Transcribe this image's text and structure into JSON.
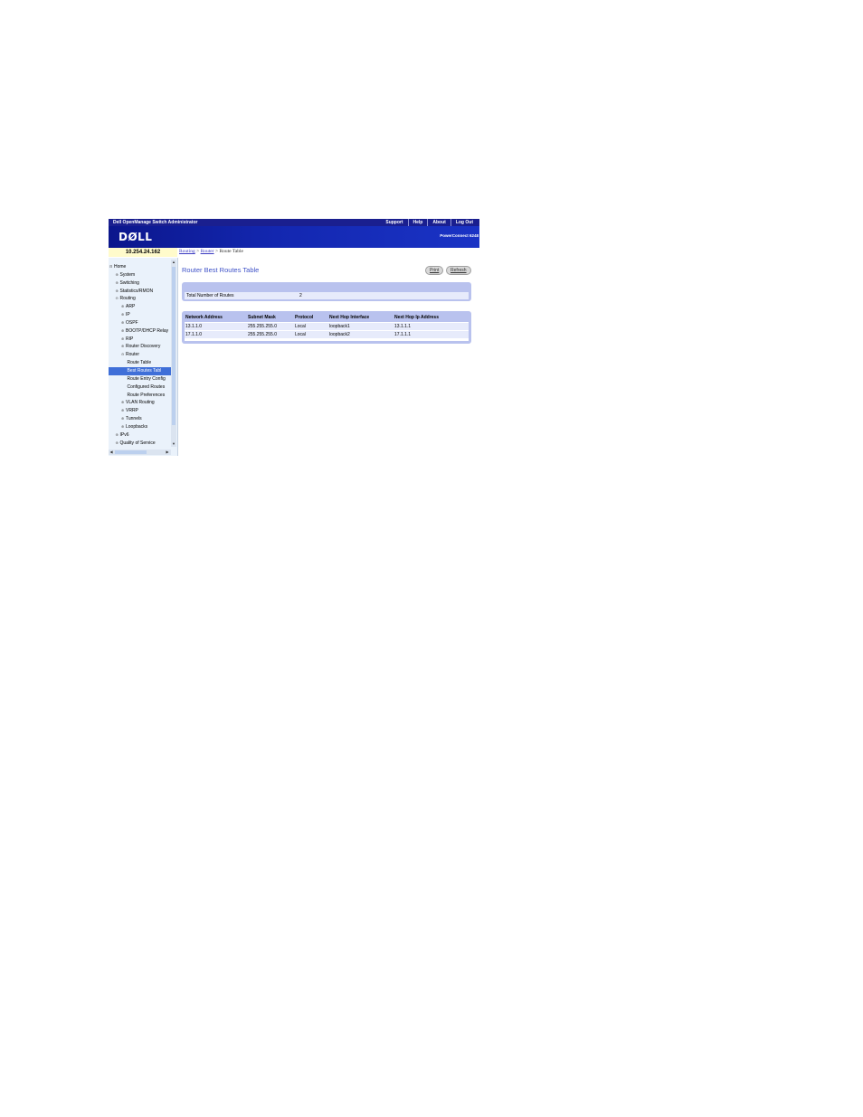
{
  "header": {
    "app_title": "Dell OpenManage Switch Administrator",
    "links": [
      "Support",
      "Help",
      "About",
      "Log Out"
    ],
    "logo_text": "DØLL",
    "model": "PowerConnect 6248"
  },
  "ip_address": "10.254.24.162",
  "breadcrumb": {
    "items": [
      "Routing",
      "Router",
      "Route Table"
    ],
    "separator": ">"
  },
  "sidebar": {
    "items": [
      {
        "label": "Home",
        "level": 0,
        "expander": "⊟"
      },
      {
        "label": "System",
        "level": 1,
        "expander": "⊕"
      },
      {
        "label": "Switching",
        "level": 1,
        "expander": "⊕"
      },
      {
        "label": "Statistics/RMON",
        "level": 1,
        "expander": "⊕"
      },
      {
        "label": "Routing",
        "level": 1,
        "expander": "⊖"
      },
      {
        "label": "ARP",
        "level": 2,
        "expander": "⊕"
      },
      {
        "label": "IP",
        "level": 2,
        "expander": "⊕"
      },
      {
        "label": "OSPF",
        "level": 2,
        "expander": "⊕"
      },
      {
        "label": "BOOTP/DHCP Relay",
        "level": 2,
        "expander": "⊕"
      },
      {
        "label": "RIP",
        "level": 2,
        "expander": "⊕"
      },
      {
        "label": "Router Discovery",
        "level": 2,
        "expander": "⊕"
      },
      {
        "label": "Router",
        "level": 2,
        "expander": "⊖"
      },
      {
        "label": "Route Table",
        "level": 3,
        "expander": ""
      },
      {
        "label": "Best Routes Tabl",
        "level": 3,
        "expander": "",
        "selected": true
      },
      {
        "label": "Route Entry Config",
        "level": 3,
        "expander": ""
      },
      {
        "label": "Configured Routes",
        "level": 3,
        "expander": ""
      },
      {
        "label": "Route Preferences",
        "level": 3,
        "expander": ""
      },
      {
        "label": "VLAN Routing",
        "level": 2,
        "expander": "⊕"
      },
      {
        "label": "VRRP",
        "level": 2,
        "expander": "⊕"
      },
      {
        "label": "Tunnels",
        "level": 2,
        "expander": "⊕"
      },
      {
        "label": "Loopbacks",
        "level": 2,
        "expander": "⊕"
      },
      {
        "label": "IPv6",
        "level": 1,
        "expander": "⊕"
      },
      {
        "label": "Quality of Service",
        "level": 1,
        "expander": "⊕"
      }
    ]
  },
  "page": {
    "title": "Router Best Routes Table",
    "print_label": "Print",
    "refresh_label": "Refresh",
    "summary": {
      "label": "Total Number of Routes",
      "value": "2"
    },
    "table": {
      "columns": [
        "Network Address",
        "Subnet Mask",
        "Protocol",
        "Next Hop Interface",
        "Next Hop Ip Address"
      ],
      "rows": [
        [
          "13.1.1.0",
          "255.255.255.0",
          "Local",
          "loopback1",
          "13.1.1.1"
        ],
        [
          "17.1.1.0",
          "255.255.255.0",
          "Local",
          "loopback2",
          "17.1.1.1"
        ]
      ]
    }
  },
  "colors": {
    "banner": "#1327b0",
    "title": "#3f52c8",
    "panel": "#b9c2ee",
    "selected": "#3f6fd8",
    "ip_bar": "#fffbcb"
  }
}
